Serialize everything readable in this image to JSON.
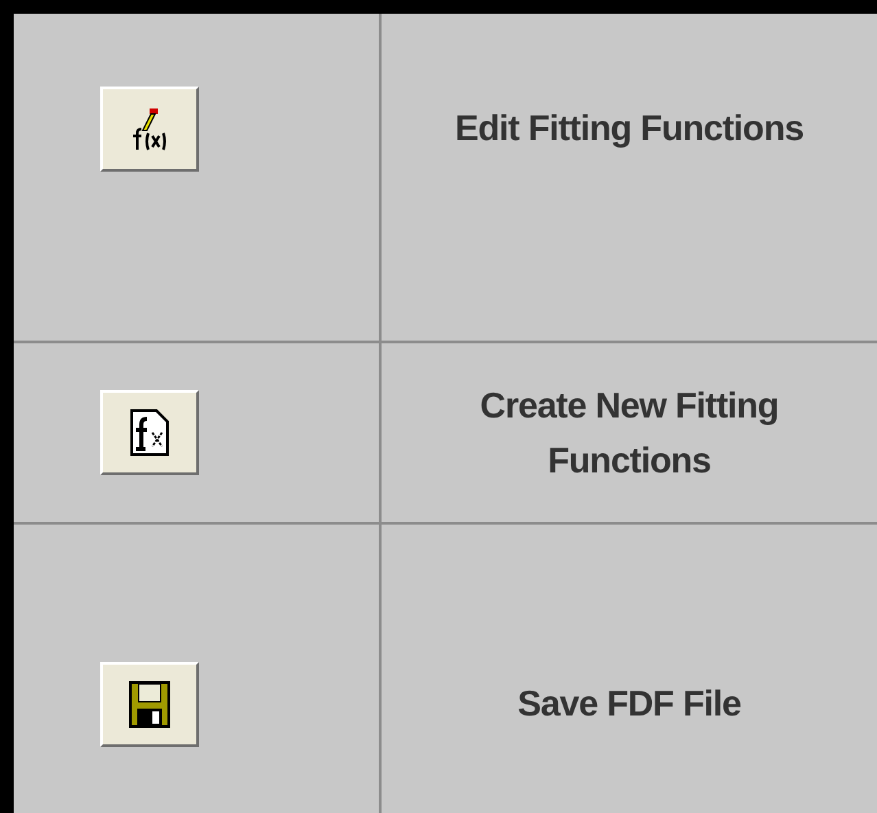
{
  "rows": [
    {
      "kind": "edit",
      "label": "Edit Fitting Functions"
    },
    {
      "kind": "create",
      "label": "Create New Fitting Functions"
    },
    {
      "kind": "save",
      "label": "Save FDF File"
    }
  ]
}
